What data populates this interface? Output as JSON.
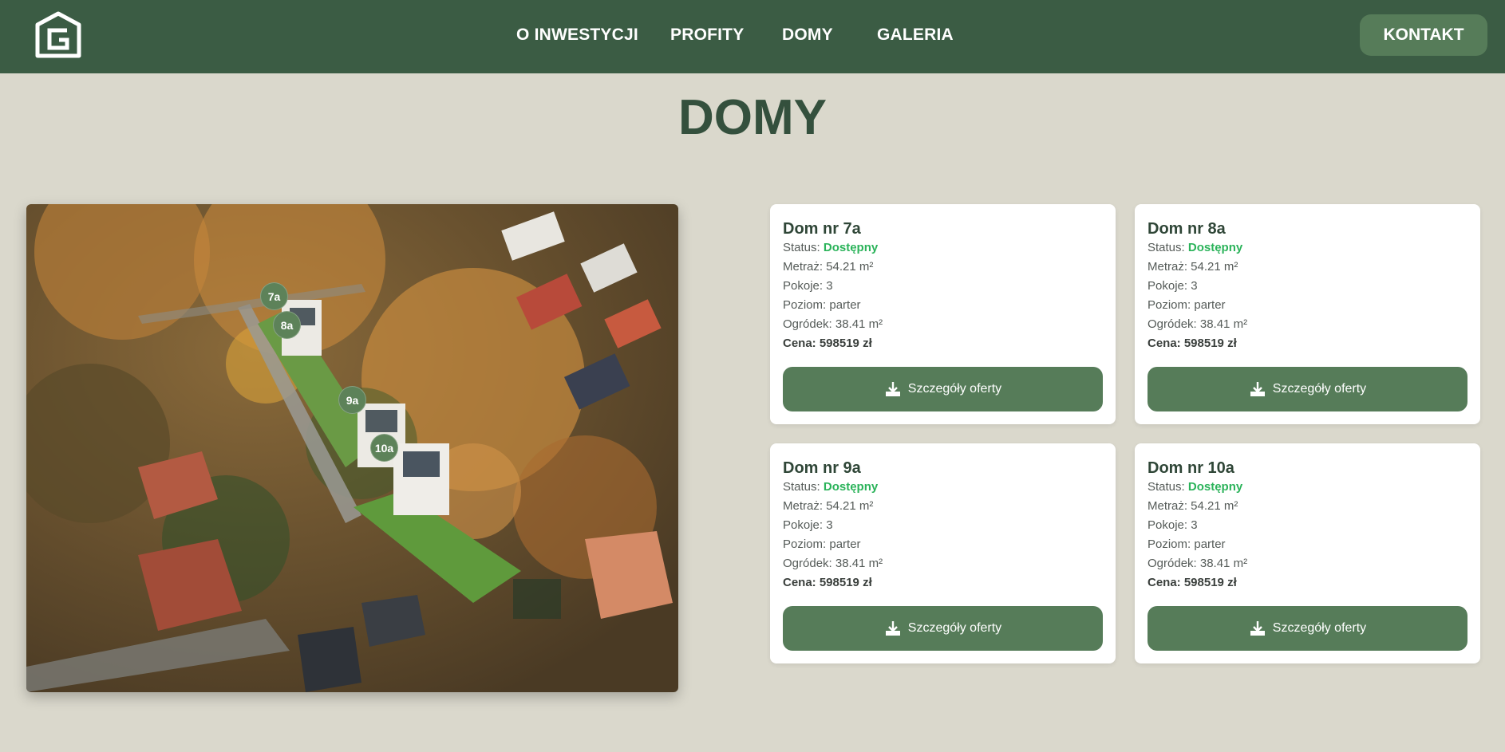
{
  "header": {
    "logo_alt": "G",
    "nav": [
      "O INWESTYCJI",
      "PROFITY",
      "DOMY",
      "GALERIA"
    ],
    "contact_label": "KONTAKT"
  },
  "main": {
    "title": "DOMY",
    "map_pins": [
      "7a",
      "8a",
      "9a",
      "10a"
    ]
  },
  "houses": [
    {
      "name": "Dom nr 7a",
      "status_label": "Status: ",
      "status": "Dostępny",
      "area": "Metraż: 54.21 m²",
      "rooms": "Pokoje: 3",
      "level": "Poziom: parter",
      "garden": "Ogródek: 38.41 m²",
      "price": "Cena: 598519 zł",
      "button": "Szczegóły oferty"
    },
    {
      "name": "Dom nr 8a",
      "status_label": "Status: ",
      "status": "Dostępny",
      "area": "Metraż: 54.21 m²",
      "rooms": "Pokoje: 3",
      "level": "Poziom: parter",
      "garden": "Ogródek: 38.41 m²",
      "price": "Cena: 598519 zł",
      "button": "Szczegóły oferty"
    },
    {
      "name": "Dom nr 9a",
      "status_label": "Status: ",
      "status": "Dostępny",
      "area": "Metraż: 54.21 m²",
      "rooms": "Pokoje: 3",
      "level": "Poziom: parter",
      "garden": "Ogródek: 38.41 m²",
      "price": "Cena: 598519 zł",
      "button": "Szczegóły oferty"
    },
    {
      "name": "Dom nr 10a",
      "status_label": "Status: ",
      "status": "Dostępny",
      "area": "Metraż: 54.21 m²",
      "rooms": "Pokoje: 3",
      "level": "Poziom: parter",
      "garden": "Ogródek: 38.41 m²",
      "price": "Cena: 598519 zł",
      "button": "Szczegóły oferty"
    }
  ],
  "colors": {
    "header_bg": "#3b5c44",
    "accent": "#567c59",
    "page_bg": "#dad8cc",
    "status_available": "#2bb35a"
  },
  "icons": [
    "logo-icon",
    "download-icon"
  ]
}
